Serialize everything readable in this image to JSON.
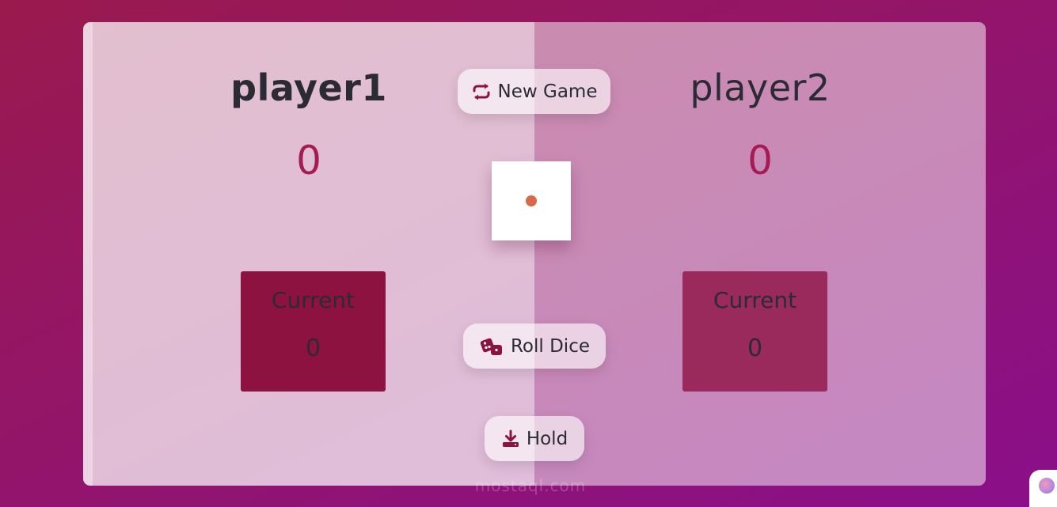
{
  "players": [
    {
      "name": "player1",
      "score": "0",
      "current_label": "Current",
      "current_score": "0"
    },
    {
      "name": "player2",
      "score": "0",
      "current_label": "Current",
      "current_score": "0"
    }
  ],
  "controls": {
    "new_game_label": "New Game",
    "roll_dice_label": "Roll Dice",
    "hold_label": "Hold"
  },
  "dice": {
    "value": 1
  },
  "watermark": "mostaql.com",
  "icons": {
    "new_game": "repeat-icon",
    "roll_dice": "dice-icon",
    "hold": "download-icon"
  },
  "colors": {
    "accent": "#a51b55",
    "active_current_bg": "#8e1240",
    "inactive_current_bg": "#9a2a5c",
    "dice_pip": "#d9684a"
  }
}
